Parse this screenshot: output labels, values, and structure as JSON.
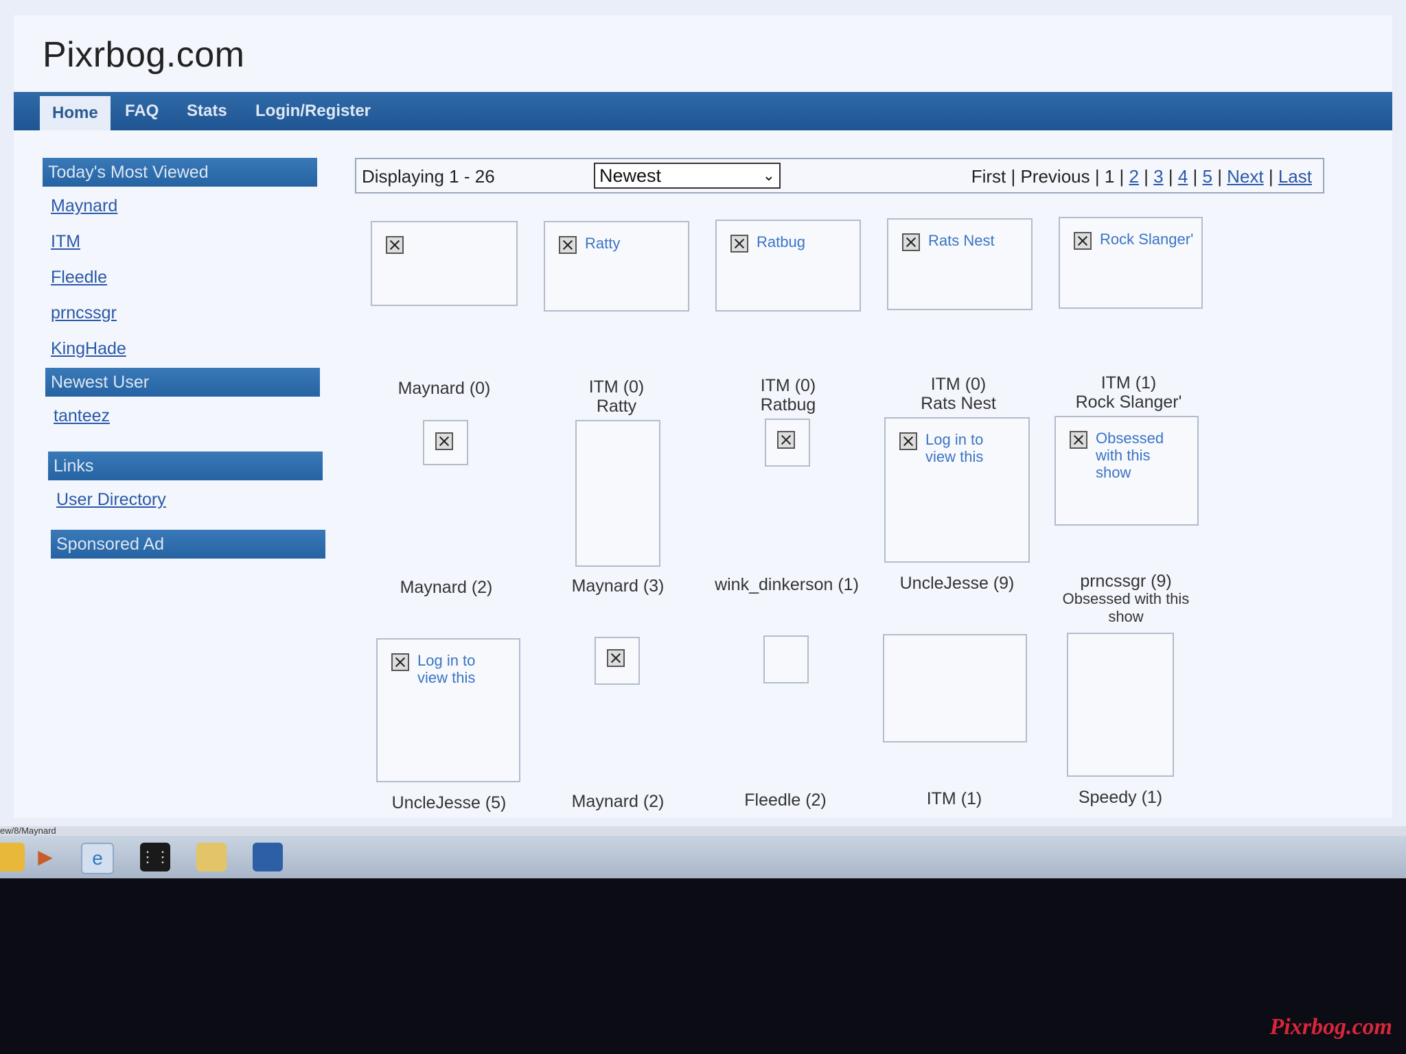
{
  "site": {
    "title": "Pixrbog.com"
  },
  "nav": {
    "items": [
      "Home",
      "FAQ",
      "Stats",
      "Login/Register"
    ]
  },
  "sidebar": {
    "most_viewed_title": "Today's Most Viewed",
    "most_viewed": [
      "Maynard",
      "ITM",
      "Fleedle",
      "prncssgr",
      "KingHade"
    ],
    "newest_user_title": "Newest User",
    "newest_user": "tanteez",
    "links_title": "Links",
    "links": [
      "User Directory"
    ],
    "sponsored_title": "Sponsored Ad"
  },
  "toolbar": {
    "displaying": "Displaying 1 - 26",
    "sort_value": "Newest",
    "pager": {
      "first": "First",
      "previous": "Previous",
      "current": "1",
      "pages": [
        "2",
        "3",
        "4",
        "5"
      ],
      "next": "Next",
      "last": "Last"
    }
  },
  "row1": {
    "cards": [
      "",
      "Ratty",
      "Ratbug",
      "Rats Nest",
      "Rock Slanger'"
    ],
    "captions": [
      {
        "user": "Maynard (0)",
        "title": ""
      },
      {
        "user": "ITM (0)",
        "title": "Ratty"
      },
      {
        "user": "ITM (0)",
        "title": "Ratbug"
      },
      {
        "user": "ITM (0)",
        "title": "Rats Nest"
      },
      {
        "user": "ITM (1)",
        "title": "Rock Slanger'"
      }
    ]
  },
  "row2": {
    "cards": [
      "",
      "",
      "",
      "Log in to view this",
      "Obsessed with this show"
    ],
    "captions": [
      {
        "user": "Maynard (2)",
        "title": ""
      },
      {
        "user": "Maynard (3)",
        "title": ""
      },
      {
        "user": "wink_dinkerson (1)",
        "title": ""
      },
      {
        "user": "UncleJesse (9)",
        "title": ""
      },
      {
        "user": "prncssgr (9)",
        "title": "Obsessed with this show"
      }
    ]
  },
  "row3": {
    "cards": [
      "Log in to view this",
      "",
      "",
      "",
      ""
    ],
    "captions": [
      "UncleJesse (5)",
      "Maynard (2)",
      "Fleedle (2)",
      "ITM (1)",
      "Speedy (1)"
    ]
  },
  "status_bar": {
    "url": "ew/8/Maynard"
  },
  "watermark": "Pixrbog.com"
}
